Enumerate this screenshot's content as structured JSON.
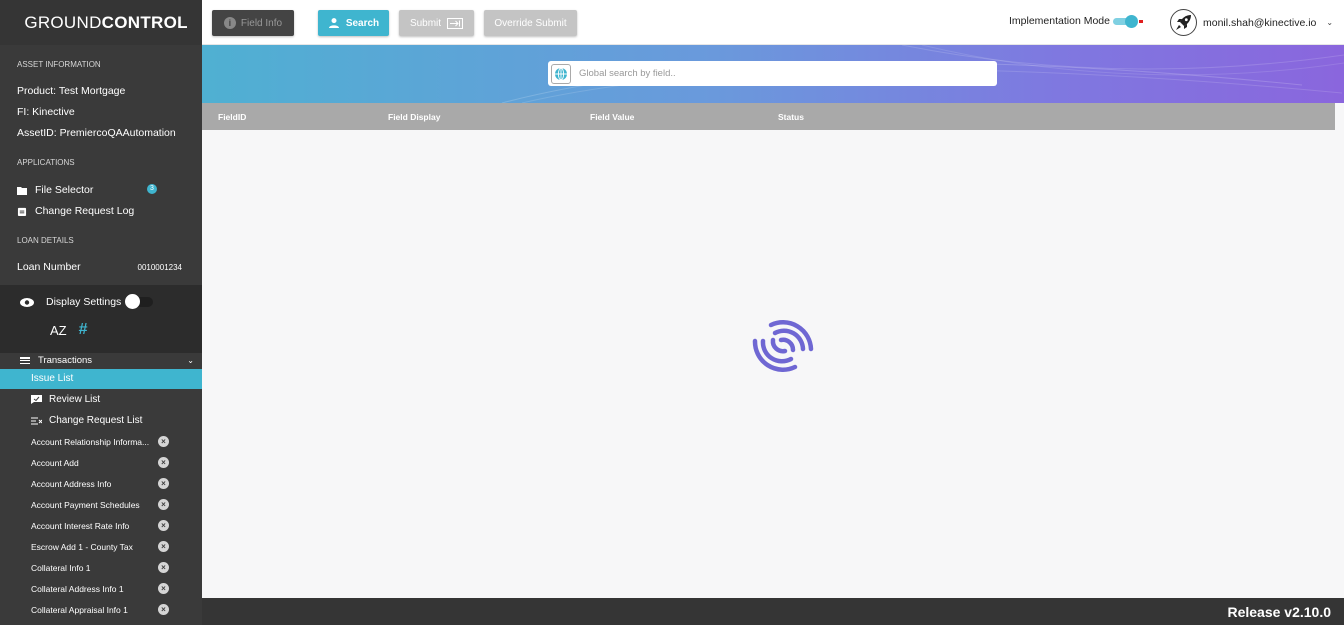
{
  "brand": {
    "name_light": "GROUND",
    "name_bold": "CONTROL"
  },
  "asset": {
    "heading": "ASSET INFORMATION",
    "product": "Product:  Test Mortgage",
    "fi": "FI:  Kinective",
    "asset_id": "AssetID:  PremiercoQAAutomation"
  },
  "applications": {
    "heading": "APPLICATIONS",
    "file_selector": "File Selector",
    "file_selector_badge": "3",
    "change_request_log": "Change Request Log"
  },
  "loan": {
    "heading": "LOAN DETAILS",
    "label": "Loan Number",
    "value": "0010001234"
  },
  "display_settings": {
    "label": "Display Settings",
    "sort_az": "AZ",
    "sort_hash": "#"
  },
  "transactions": {
    "label": "Transactions",
    "issue_list": "Issue List",
    "review_list": "Review List",
    "change_request_list": "Change Request List",
    "items": [
      "Account Relationship Informa...",
      "Account Add",
      "Account Address Info",
      "Account Payment Schedules",
      "Account Interest Rate Info",
      "Escrow Add 1 - County Tax",
      "Collateral Info 1",
      "Collateral Address Info 1",
      "Collateral Appraisal Info 1"
    ]
  },
  "toolbar": {
    "field_info": "Field Info",
    "search": "Search",
    "submit": "Submit",
    "override_submit": "Override Submit",
    "implementation_mode": "Implementation Mode",
    "user_email": "monil.shah@kinective.io"
  },
  "search": {
    "placeholder": "Global search by field.."
  },
  "table": {
    "columns": [
      "FieldID",
      "Field Display",
      "Field Value",
      "Status"
    ]
  },
  "footer": {
    "release": "Release v2.10.0"
  },
  "colors": {
    "accent": "#3fb5cf",
    "sidebar": "#3a3a3a",
    "spinner": "#6f67d3",
    "toggle_off_red": "#e01e1e"
  }
}
